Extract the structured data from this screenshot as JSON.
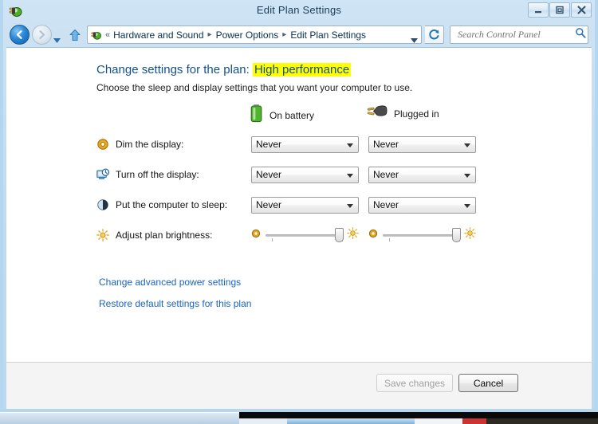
{
  "window": {
    "title": "Edit Plan Settings",
    "app_icon": "power-plug-battery-icon",
    "controls": {
      "minimize": "minimize-button",
      "maximize": "maximize-button",
      "close": "close-button"
    }
  },
  "nav": {
    "back": "back-button",
    "forward": "forward-button",
    "history": "history-dropdown",
    "up": "up-one-level-button",
    "refresh": "refresh-button",
    "chevron": "«",
    "separator": "▸",
    "breadcrumbs": [
      {
        "label": "Hardware and Sound"
      },
      {
        "label": "Power Options"
      },
      {
        "label": "Edit Plan Settings"
      }
    ]
  },
  "search": {
    "placeholder": "Search Control Panel",
    "value": "",
    "icon": "search-icon"
  },
  "main": {
    "heading_prefix": "Change settings for the plan:",
    "plan_name": "High performance",
    "highlight_color": "#ffff00",
    "subheading": "Choose the sleep and display settings that you want your computer to use.",
    "columns": [
      {
        "label": "On battery",
        "icon": "battery-icon"
      },
      {
        "label": "Plugged in",
        "icon": "power-plug-icon"
      }
    ],
    "rows": [
      {
        "label": "Dim the display:",
        "icon": "dim-display-icon",
        "on_battery": "Never",
        "plugged_in": "Never"
      },
      {
        "label": "Turn off the display:",
        "icon": "monitor-clock-icon",
        "on_battery": "Never",
        "plugged_in": "Never"
      },
      {
        "label": "Put the computer to sleep:",
        "icon": "sleep-moon-icon",
        "on_battery": "Never",
        "plugged_in": "Never"
      }
    ],
    "brightness": {
      "label": "Adjust plan brightness:",
      "icon": "brightness-sun-icon",
      "low_icon": "brightness-low-icon",
      "high_icon": "brightness-high-icon",
      "on_battery_value": 88,
      "plugged_in_value": 88
    },
    "links": [
      {
        "label": "Change advanced power settings"
      },
      {
        "label": "Restore default settings for this plan"
      }
    ]
  },
  "footer": {
    "save_label": "Save changes",
    "save_enabled": false,
    "cancel_label": "Cancel",
    "cancel_enabled": true
  }
}
